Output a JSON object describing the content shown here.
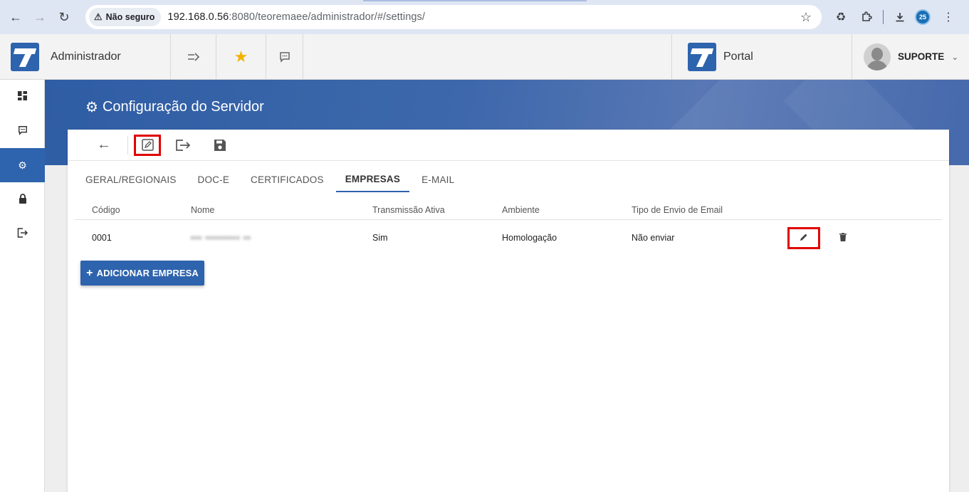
{
  "browser": {
    "security_label": "Não seguro",
    "url_host": "192.168.0.56",
    "url_rest": ":8080/teoremaee/administrador/#/settings/",
    "profile_badge": "25"
  },
  "header": {
    "app_title": "Administrador",
    "portal_title": "Portal",
    "user_name": "SUPORTE"
  },
  "page": {
    "title": "Configuração do Servidor"
  },
  "tabs": [
    {
      "label": "GERAL/REGIONAIS"
    },
    {
      "label": "DOC-E"
    },
    {
      "label": "CERTIFICADOS"
    },
    {
      "label": "EMPRESAS"
    },
    {
      "label": "E-MAIL"
    }
  ],
  "active_tab": "EMPRESAS",
  "table": {
    "columns": [
      "Código",
      "Nome",
      "Transmissão Ativa",
      "Ambiente",
      "Tipo de Envio de Email"
    ],
    "rows": [
      {
        "codigo": "0001",
        "nome": "▪▪▪ ▪▪▪▪▪▪▪▪▪ ▪▪",
        "transmissao": "Sim",
        "ambiente": "Homologação",
        "envio": "Não enviar"
      }
    ]
  },
  "add_button_label": "ADICIONAR EMPRESA",
  "colors": {
    "brand": "#2e63ad",
    "highlight": "#e00000",
    "favorite": "#f2b300"
  },
  "icons": {
    "browser": [
      "back-arrow",
      "forward-arrow",
      "reload",
      "warning",
      "bookmark-star",
      "recycle",
      "puzzle",
      "download",
      "kebab-menu"
    ],
    "header": [
      "menu-collapse",
      "star",
      "chat"
    ],
    "sidebar": [
      "dashboard",
      "chat",
      "gear",
      "lock",
      "logout"
    ],
    "toolbar": [
      "back-arrow",
      "edit",
      "export",
      "save"
    ],
    "row": [
      "pencil",
      "trash"
    ]
  }
}
